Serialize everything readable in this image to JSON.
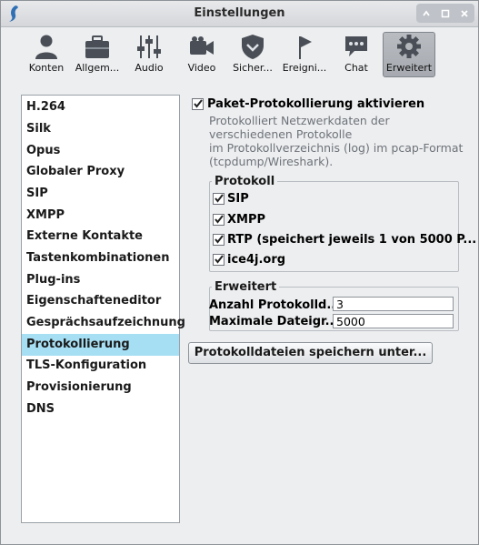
{
  "window": {
    "title": "Einstellungen"
  },
  "toolbar": {
    "items": [
      {
        "label": "Konten",
        "icon": "person-icon"
      },
      {
        "label": "Allgem...",
        "icon": "briefcase-icon"
      },
      {
        "label": "Audio",
        "icon": "mixer-sliders-icon"
      },
      {
        "label": "Video",
        "icon": "video-camera-icon"
      },
      {
        "label": "Sicher...",
        "icon": "shield-icon"
      },
      {
        "label": "Ereigni...",
        "icon": "flag-icon"
      },
      {
        "label": "Chat",
        "icon": "chat-bubble-icon"
      },
      {
        "label": "Erweitert",
        "icon": "gear-icon",
        "selected": true
      }
    ]
  },
  "sidebar": {
    "items": [
      {
        "label": "H.264"
      },
      {
        "label": "Silk"
      },
      {
        "label": "Opus"
      },
      {
        "label": "Globaler Proxy"
      },
      {
        "label": "SIP"
      },
      {
        "label": "XMPP"
      },
      {
        "label": "Externe Kontakte"
      },
      {
        "label": "Tastenkombinationen"
      },
      {
        "label": "Plug-ins"
      },
      {
        "label": "Eigenschafteneditor"
      },
      {
        "label": "Gesprächsaufzeichnung"
      },
      {
        "label": "Protokollierung",
        "active": true
      },
      {
        "label": "TLS-Konfiguration"
      },
      {
        "label": "Provisionierung"
      },
      {
        "label": "DNS"
      }
    ]
  },
  "logging": {
    "enable_label": "Paket-Protokollierung aktivieren",
    "enable_checked": true,
    "description": [
      "Protokolliert Netzwerkdaten der",
      "verschiedenen Protokolle",
      "im Protokollverzeichnis (log) im pcap-Format",
      "(tcpdump/Wireshark)."
    ],
    "protocol_group": {
      "legend": "Protokoll",
      "items": [
        {
          "label": "SIP",
          "checked": true
        },
        {
          "label": "XMPP",
          "checked": true
        },
        {
          "label": "RTP (speichert jeweils 1 von 5000 P...",
          "checked": true
        },
        {
          "label": "ice4j.org",
          "checked": true
        }
      ]
    },
    "advanced_group": {
      "legend": "Erweitert",
      "file_count_label": "Anzahl Protokolld...",
      "file_count_value": "3",
      "max_size_label": "Maximale Dateigr...",
      "max_size_value": "5000"
    },
    "save_button": "Protokolldateien speichern unter..."
  },
  "colors": {
    "selection": "#a6dff4",
    "description_text": "#6d7278"
  }
}
